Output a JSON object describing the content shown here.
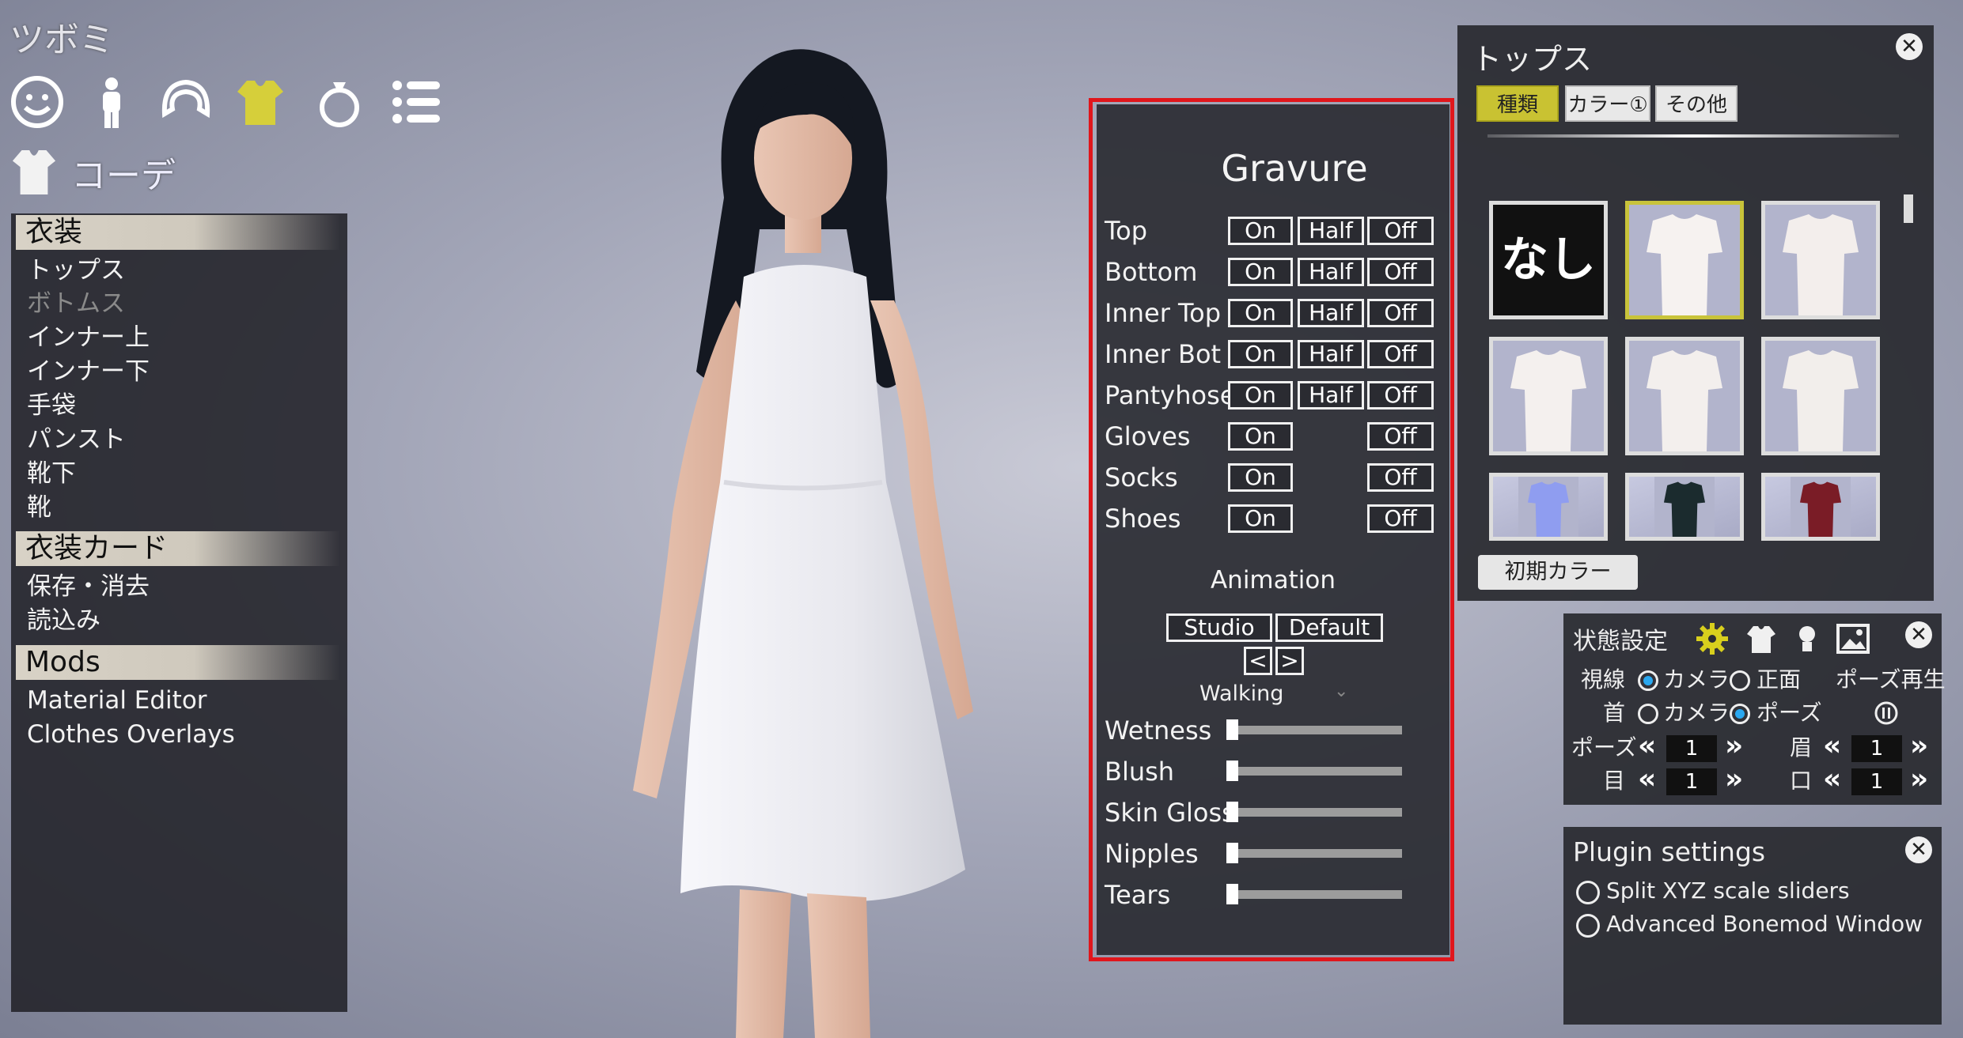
{
  "character_name": "ツボミ",
  "category_icons": [
    "face-icon",
    "body-icon",
    "hair-icon",
    "clothes-icon",
    "accessory-icon",
    "list-icon"
  ],
  "sub_category": {
    "label": "コーデ"
  },
  "left_menu": {
    "sections": [
      {
        "header": "衣装",
        "items": [
          "トップス",
          "ボトムス",
          "インナー上",
          "インナー下",
          "手袋",
          "パンスト",
          "靴下",
          "靴"
        ]
      },
      {
        "header": "衣装カード",
        "items": [
          "保存・消去",
          "読込み"
        ]
      },
      {
        "header": "Mods",
        "items": [
          "Material Editor",
          "Clothes Overlays"
        ]
      }
    ]
  },
  "gravure": {
    "title": "Gravure",
    "rows": [
      {
        "label": "Top",
        "on": "On",
        "half": "Half",
        "off": "Off"
      },
      {
        "label": "Bottom",
        "on": "On",
        "half": "Half",
        "off": "Off"
      },
      {
        "label": "Inner Top",
        "on": "On",
        "half": "Half",
        "off": "Off"
      },
      {
        "label": "Inner Bot",
        "on": "On",
        "half": "Half",
        "off": "Off"
      },
      {
        "label": "Pantyhose",
        "on": "On",
        "half": "Half",
        "off": "Off"
      },
      {
        "label": "Gloves",
        "on": "On",
        "off": "Off"
      },
      {
        "label": "Socks",
        "on": "On",
        "off": "Off"
      },
      {
        "label": "Shoes",
        "on": "On",
        "off": "Off"
      }
    ],
    "animation": {
      "title": "Animation",
      "studio_label": "Studio",
      "default_label": "Default",
      "prev_label": "<",
      "next_label": ">",
      "current": "Walking"
    },
    "sliders": [
      {
        "label": "Wetness",
        "value": 0
      },
      {
        "label": "Blush",
        "value": 0
      },
      {
        "label": "Skin Gloss",
        "value": 0
      },
      {
        "label": "Nipples",
        "value": 0
      },
      {
        "label": "Tears",
        "value": 0
      }
    ]
  },
  "tops_panel": {
    "title": "トップス",
    "tabs": [
      {
        "label": "種類",
        "active": true
      },
      {
        "label": "カラー①",
        "active": false
      },
      {
        "label": "その他",
        "active": false
      }
    ],
    "none_label": "なし",
    "thumb_colors": [
      "#f6f2f0",
      "#f3eeec",
      "#f4f0ee",
      "#f3efed",
      "#f2eeeb",
      "#8f9df0",
      "#1b2b2e",
      "#7a1c26"
    ],
    "initial_color_button": "初期カラー"
  },
  "status_panel": {
    "title": "状態設定",
    "gaze_label": "視線",
    "neck_label": "首",
    "camera_label": "カメラ",
    "front_label": "正面",
    "pose_label": "ポーズ",
    "pose_play_label": "ポーズ再生",
    "pose_row_label": "ポーズ",
    "eyebrow_label": "眉",
    "eye_label": "目",
    "mouth_label": "口",
    "pose_value": "1",
    "eyebrow_value": "1",
    "eye_value": "1",
    "mouth_value": "1"
  },
  "plugin_panel": {
    "title": "Plugin settings",
    "options": [
      "Split XYZ scale sliders",
      "Advanced Bonemod Window"
    ]
  }
}
